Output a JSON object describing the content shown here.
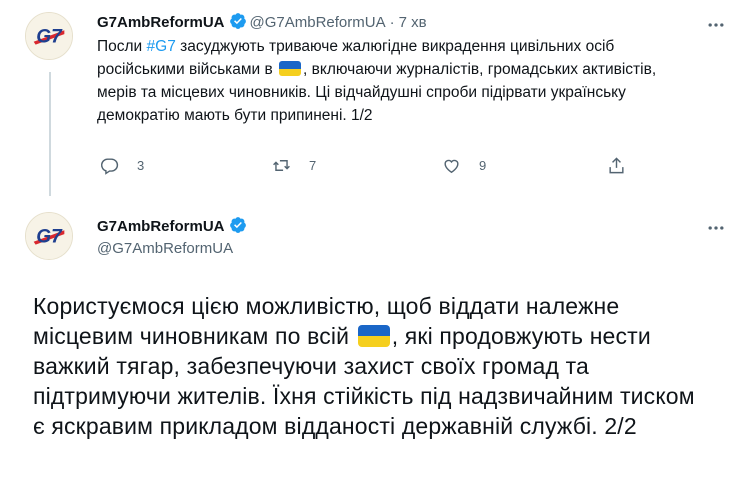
{
  "tweet1": {
    "display_name": "G7AmbReformUA",
    "handle": "@G7AmbReformUA",
    "separator": "·",
    "time": "7 хв",
    "text_part1": "Посли ",
    "hashtag": "#G7",
    "text_part2": " засуджують триваюче жалюгідне викрадення цивільних осіб російськими військами в ",
    "text_part3": ", включаючи журналістів, громадських активістів, мерів та місцевих чиновників. Ці відчайдушні спроби підірвати українську демократію мають бути припинені. 1/2",
    "reply_count": "3",
    "retweet_count": "7",
    "like_count": "9",
    "flag_emoji": "flag-ukraine"
  },
  "tweet2": {
    "display_name": "G7AmbReformUA",
    "handle": "@G7AmbReformUA",
    "text_part1": "Користуємося цією можливістю, щоб віддати належне місцевим чиновникам по всій ",
    "text_part2": ", які продовжують нести важкий тягар, забезпечуючи захист своїх громад та підтримуючи жителів. Їхня стійкість під надзвичайним тиском є яскравим прикладом відданості державній службі. 2/2",
    "flag_emoji": "flag-ukraine"
  },
  "avatar": {
    "logo_text": "G7",
    "colors": {
      "red": "#d9282f",
      "blue": "#1f3f8f",
      "cream": "#f7f3e7"
    }
  },
  "colors": {
    "accent": "#1d9bf0",
    "muted": "#536471",
    "verified": "#1d9bf0"
  },
  "icons": [
    "more-icon",
    "reply-icon",
    "retweet-icon",
    "like-icon",
    "share-icon",
    "verified-icon"
  ]
}
